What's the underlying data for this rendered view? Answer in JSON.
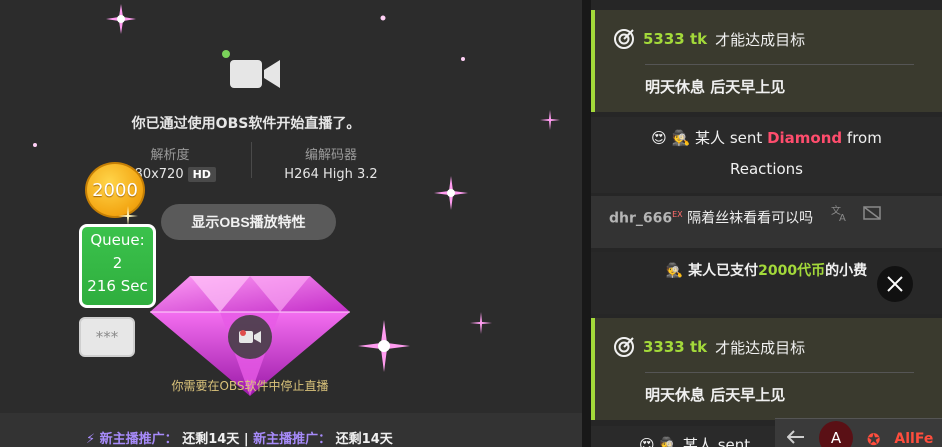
{
  "broadcast": {
    "obs_started": "你已通过使用OBS软件开始直播了。",
    "resolution_label": "解析度",
    "resolution_value": "1280x720",
    "hd_badge": "HD",
    "codec_label": "编解码器",
    "codec_value": "H264 High 3.2",
    "obs_button": "显示OBS播放特性",
    "coin_amount": "2000",
    "queue_label": "Queue:",
    "queue_count": "2",
    "queue_time": "216 Sec",
    "masked": "***",
    "stop_hint": "你需要在OBS软件中停止直播",
    "promo_a": "新主播推广：",
    "promo_b": "还剩14天",
    "promo_c": "新主播推广：",
    "promo_d": "还剩14天"
  },
  "chat": {
    "goal1_amount": "5333 tk",
    "goal1_text": "才能达成目标",
    "goal1_note": "明天休息 后天早上见",
    "gift_who": "某人",
    "gift_sent": "sent",
    "gift_item": "Diamond",
    "gift_from": "from",
    "gift_source": "Reactions",
    "msg_user": "dhr_666",
    "msg_badge": "EX",
    "msg_text": "隔着丝袜看看可以吗",
    "tip_who": "某人",
    "tip_paid": "已支付",
    "tip_amount": "2000代币",
    "tip_suffix": "的小费",
    "goal2_amount": "3333 tk",
    "goal2_text": "才能达成目标",
    "goal2_note": "明天休息 后天早上见",
    "bottom_who": "某人",
    "bottom_sent": "sent"
  },
  "browser": {
    "avatar_letter": "A",
    "site_label": "AllFe"
  },
  "colors": {
    "goal_accent": "#a3d93a",
    "diamond_red": "#ff4d6d",
    "queue_green": "#3bc24c",
    "coin_gold": "#f3a511"
  }
}
